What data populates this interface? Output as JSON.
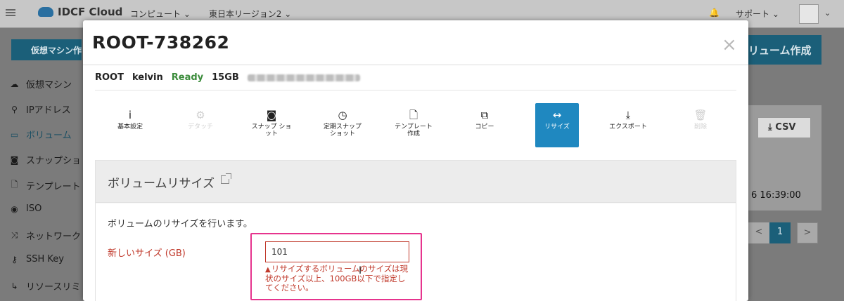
{
  "topbar": {
    "brand": "IDCF Cloud",
    "nav_compute": "コンピュート ⌄",
    "nav_region": "東日本リージョン2 ⌄",
    "support": "サポート ⌄",
    "avatar_chevron": "⌄"
  },
  "sidebar": {
    "create_vm_button": "仮想マシン作",
    "items": [
      {
        "label": "仮想マシン",
        "icon": "cloud-icon"
      },
      {
        "label": "IPアドレス",
        "icon": "sitemap-icon"
      },
      {
        "label": "ボリューム",
        "icon": "hdd-icon"
      },
      {
        "label": "スナップショ",
        "icon": "camera-icon"
      },
      {
        "label": "テンプレート",
        "icon": "file-icon"
      },
      {
        "label": "ISO",
        "icon": "disc-icon"
      },
      {
        "label": "ネットワーク",
        "icon": "shuffle-icon"
      },
      {
        "label": "SSH Key",
        "icon": "key-icon"
      },
      {
        "label": "リソースリミ",
        "icon": "arrow-icon"
      }
    ]
  },
  "background": {
    "create_volume_button": "リューム作成",
    "csv_button": "CSV",
    "date_text": "6 16:39:00",
    "pager": {
      "prev": "<",
      "current": "1",
      "next": ">"
    }
  },
  "modal": {
    "title": "ROOT-738262",
    "close": "×",
    "meta": {
      "type": "ROOT",
      "owner": "kelvin",
      "status": "Ready",
      "size": "15GB"
    },
    "tabs": [
      {
        "label": "基本設定",
        "icon": "info-icon",
        "glyph": "i",
        "state": "normal"
      },
      {
        "label": "デタッチ",
        "icon": "gear-icon",
        "glyph": "⚙",
        "state": "disabled"
      },
      {
        "label": "スナップ ショット",
        "icon": "camera-icon",
        "glyph": "◙",
        "state": "normal"
      },
      {
        "label": "定期スナップ ショット",
        "icon": "clock-icon",
        "glyph": "◷",
        "state": "normal"
      },
      {
        "label": "テンプレート 作成",
        "icon": "file-icon",
        "glyph": "🗋",
        "state": "normal"
      },
      {
        "label": "コピー",
        "icon": "copy-icon",
        "glyph": "⧉",
        "state": "normal"
      },
      {
        "label": "リサイズ",
        "icon": "resize-icon",
        "glyph": "↔",
        "state": "active"
      },
      {
        "label": "エクスポート",
        "icon": "download-icon",
        "glyph": "⤓",
        "state": "normal"
      },
      {
        "label": "削除",
        "icon": "trash-icon",
        "glyph": "🗑",
        "state": "disabled"
      }
    ],
    "section": {
      "title": "ボリュームリサイズ",
      "description": "ボリュームのリサイズを行います。",
      "field_label": "新しいサイズ (GB)",
      "input_value": "101",
      "error_text": "リサイズするボリュームのサイズは現状のサイズ以上、100GB以下で指定してください。"
    }
  }
}
